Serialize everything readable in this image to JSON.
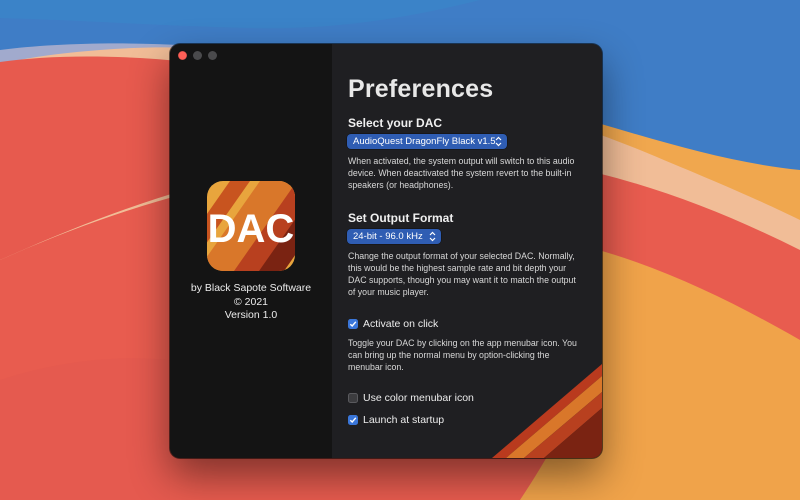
{
  "window": {
    "colors": {
      "accent": "#2f5db3",
      "checkbox_on": "#3a76d9",
      "close": "#fe5f57"
    }
  },
  "sidebar": {
    "logo_text": "DAC",
    "author": "by Black Sapote Software",
    "copyright": "© 2021",
    "version": "Version 1.0"
  },
  "preferences": {
    "title": "Preferences",
    "dac": {
      "heading": "Select your DAC",
      "selected": "AudioQuest DragonFly Black v1.5",
      "help": "When activated, the system output will switch to this audio device. When deactivated the system revert to the built-in speakers (or headphones)."
    },
    "format": {
      "heading": "Set Output Format",
      "selected": "24-bit - 96.0 kHz",
      "help": "Change the output format of your selected DAC. Normally, this would be the highest sample rate and bit depth your DAC supports, though you may want it to match the output of your music player."
    },
    "activate": {
      "label": "Activate on click",
      "checked": true,
      "help": "Toggle your DAC by clicking on the app menubar icon. You can bring up the normal menu by option-clicking the menubar icon."
    },
    "color_icon": {
      "label": "Use color menubar icon",
      "checked": false
    },
    "startup": {
      "label": "Launch at startup",
      "checked": true
    }
  },
  "icons": [
    "close-icon",
    "minimize-icon",
    "zoom-icon",
    "dac-logo-icon",
    "popup-chevron-icon",
    "checkmark-icon"
  ]
}
